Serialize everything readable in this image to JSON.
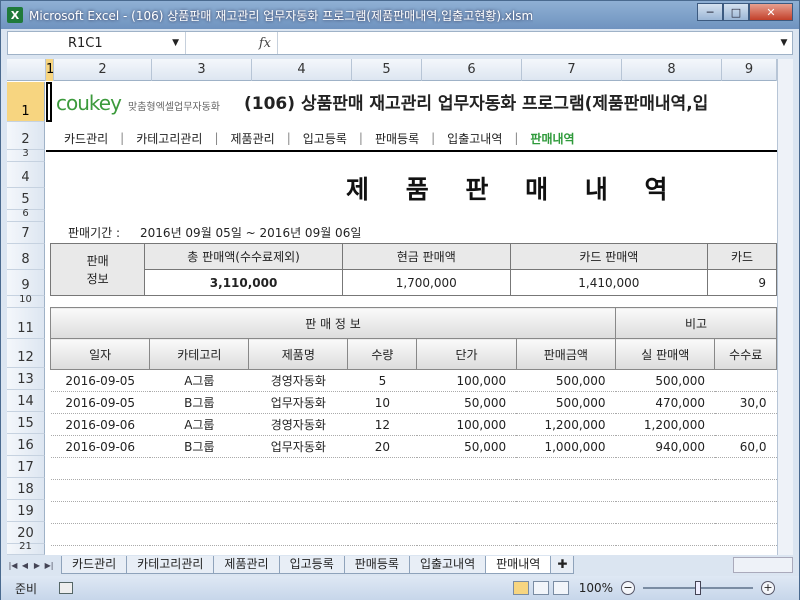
{
  "window": {
    "title": "Microsoft Excel - (106) 상품판매 재고관리 업무자동화 프로그램(제품판매내역,입출고현황).xlsm",
    "app_icon": "X",
    "minimize": "─",
    "maximize": "□",
    "close": "✕"
  },
  "formula_bar": {
    "name_box": "R1C1",
    "fx": "fx",
    "value": ""
  },
  "columns": [
    "1",
    "2",
    "3",
    "4",
    "5",
    "6",
    "7",
    "8",
    "9"
  ],
  "rows": [
    "1",
    "2",
    "3",
    "4",
    "5",
    "6",
    "7",
    "8",
    "9",
    "10",
    "11",
    "12",
    "13",
    "14",
    "15",
    "16",
    "17",
    "18",
    "19",
    "20",
    "21"
  ],
  "sheet": {
    "logo": "coukey",
    "logo_sub": "맞춤형엑셀업무자동화",
    "title": "(106) 상품판매 재고관리 업무자동화 프로그램(제품판매내역,입",
    "nav": [
      "카드관리",
      "카테고리관리",
      "제품관리",
      "입고등록",
      "판매등록",
      "입출고내역",
      "판매내역"
    ],
    "nav_active": 6,
    "main_title": "제 품 판 매 내 역",
    "period_label": "판매기간 :",
    "period_value": "2016년 09월 05일 ~ 2016년 09월 06일",
    "info": {
      "label_line1": "판매",
      "label_line2": "정보",
      "headers": [
        "총 판매액(수수료제외)",
        "현금 판매액",
        "카드 판매액",
        "카드"
      ],
      "values": [
        "3,110,000",
        "1,700,000",
        "1,410,000",
        "9"
      ]
    },
    "table": {
      "group_sales": "판 매 정 보",
      "group_note": "비고",
      "headers": [
        "일자",
        "카테고리",
        "제품명",
        "수량",
        "단가",
        "판매금액",
        "실 판매액",
        "수수료"
      ],
      "rows": [
        [
          "2016-09-05",
          "A그룹",
          "경영자동화",
          "5",
          "100,000",
          "500,000",
          "500,000",
          ""
        ],
        [
          "2016-09-05",
          "B그룹",
          "업무자동화",
          "10",
          "50,000",
          "500,000",
          "470,000",
          "30,0"
        ],
        [
          "2016-09-06",
          "A그룹",
          "경영자동화",
          "12",
          "100,000",
          "1,200,000",
          "1,200,000",
          ""
        ],
        [
          "2016-09-06",
          "B그룹",
          "업무자동화",
          "20",
          "50,000",
          "1,000,000",
          "940,000",
          "60,0"
        ]
      ]
    }
  },
  "tabs": [
    "카드관리",
    "카테고리관리",
    "제품관리",
    "입고등록",
    "판매등록",
    "입출고내역",
    "판매내역"
  ],
  "active_tab": 6,
  "status": {
    "ready": "준비",
    "zoom": "100%",
    "zoom_out": "−",
    "zoom_in": "+"
  },
  "colors": {
    "accent_green": "#2e9a3a",
    "selection": "#f7d580"
  }
}
